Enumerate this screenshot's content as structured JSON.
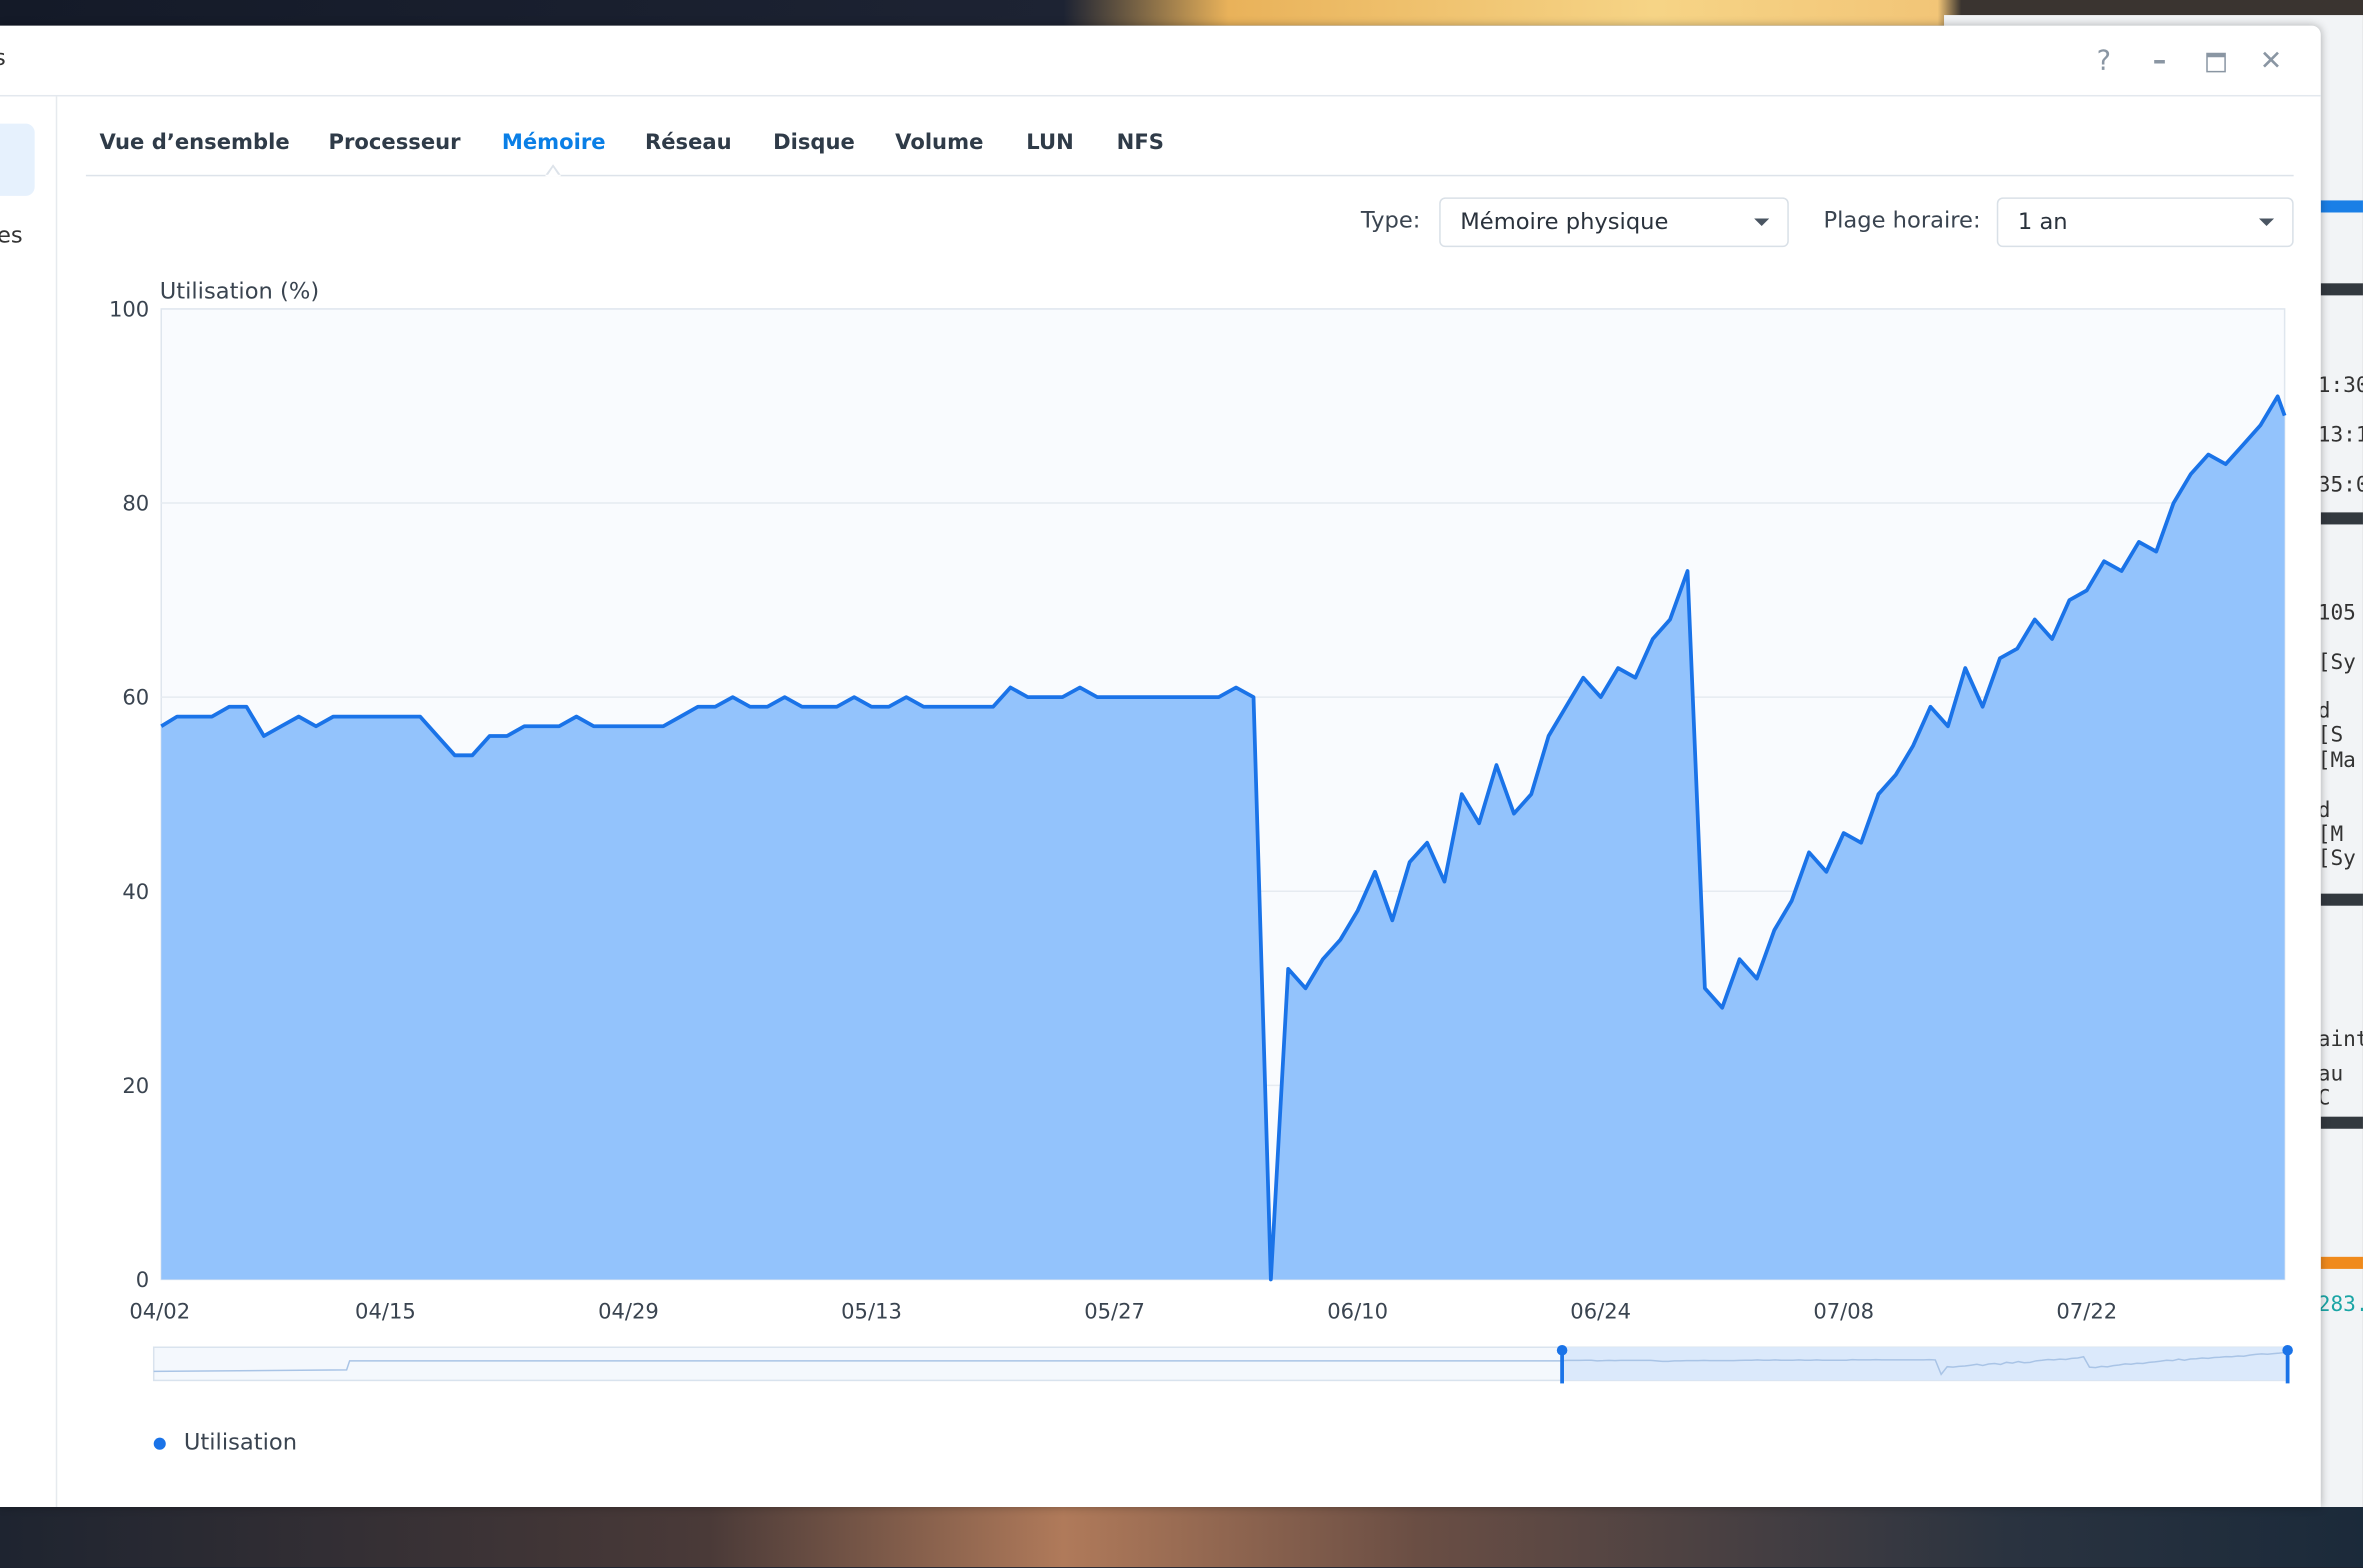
{
  "window": {
    "title_fragment": "s",
    "controls": {
      "help": "?",
      "minimize": "–",
      "maximize": "▭",
      "close": "✕"
    },
    "sidebar_fragment": "es"
  },
  "tabs": [
    {
      "label": "Vue d’ensemble",
      "active": false
    },
    {
      "label": "Processeur",
      "active": false
    },
    {
      "label": "Mémoire",
      "active": true
    },
    {
      "label": "Réseau",
      "active": false
    },
    {
      "label": "Disque",
      "active": false
    },
    {
      "label": "Volume",
      "active": false
    },
    {
      "label": "LUN",
      "active": false
    },
    {
      "label": "NFS",
      "active": false
    }
  ],
  "filters": {
    "type_label": "Type:",
    "type_value": "Mémoire physique",
    "range_label": "Plage horaire:",
    "range_value": "1 an"
  },
  "colors": {
    "accent": "#0a7fe6",
    "series_line": "#1a73e8",
    "series_fill": "#93c3fc"
  },
  "background_window_fragments": [
    "1:30",
    "13:1",
    "35:0",
    "105",
    "[Sy",
    "d [S",
    "[Ma",
    "d [M",
    "[Sy",
    "ainte",
    "au C",
    "283."
  ],
  "chart_data": {
    "type": "area",
    "title": "",
    "ylabel": "Utilisation (%)",
    "xlabel": "",
    "ylim": [
      0,
      100
    ],
    "yticks": [
      0,
      20,
      40,
      60,
      80,
      100
    ],
    "xticks": [
      "04/02",
      "04/15",
      "04/29",
      "05/13",
      "05/27",
      "06/10",
      "06/24",
      "07/08",
      "07/22"
    ],
    "grid": true,
    "legend_position": "bottom-left",
    "navigator_selection": [
      0.66,
      1.0
    ],
    "x": [
      "04/02",
      "04/03",
      "04/04",
      "04/05",
      "04/06",
      "04/07",
      "04/08",
      "04/09",
      "04/10",
      "04/11",
      "04/12",
      "04/13",
      "04/14",
      "04/15",
      "04/16",
      "04/17",
      "04/18",
      "04/19",
      "04/20",
      "04/21",
      "04/22",
      "04/23",
      "04/24",
      "04/25",
      "04/26",
      "04/27",
      "04/28",
      "04/29",
      "04/30",
      "05/01",
      "05/02",
      "05/03",
      "05/04",
      "05/05",
      "05/06",
      "05/07",
      "05/08",
      "05/09",
      "05/10",
      "05/11",
      "05/12",
      "05/13",
      "05/14",
      "05/15",
      "05/16",
      "05/17",
      "05/18",
      "05/19",
      "05/20",
      "05/21",
      "05/22",
      "05/23",
      "05/24",
      "05/25",
      "05/26",
      "05/27",
      "05/28",
      "05/29",
      "05/30",
      "05/31",
      "06/01",
      "06/02",
      "06/03",
      "06/04",
      "06/05",
      "06/06",
      "06/07",
      "06/08",
      "06/09",
      "06/10",
      "06/11",
      "06/12",
      "06/13",
      "06/14",
      "06/15",
      "06/16",
      "06/17",
      "06/18",
      "06/19",
      "06/20",
      "06/21",
      "06/22",
      "06/23",
      "06/24",
      "06/25",
      "06/26",
      "06/27",
      "06/28",
      "06/29",
      "06/30",
      "07/01",
      "07/02",
      "07/03",
      "07/04",
      "07/05",
      "07/06",
      "07/07",
      "07/08",
      "07/09",
      "07/10",
      "07/11",
      "07/12",
      "07/13",
      "07/14",
      "07/15",
      "07/16",
      "07/17",
      "07/18",
      "07/19",
      "07/20",
      "07/21",
      "07/22",
      "07/23",
      "07/24",
      "07/25",
      "07/26",
      "07/27",
      "07/28",
      "07/29",
      "07/30",
      "07/31",
      "08/01",
      "08/02",
      "08/03"
    ],
    "series": [
      {
        "name": "Utilisation",
        "values": [
          57,
          58,
          58,
          58,
          59,
          59,
          56,
          57,
          58,
          57,
          58,
          58,
          58,
          58,
          58,
          58,
          56,
          54,
          54,
          56,
          56,
          57,
          57,
          57,
          58,
          57,
          57,
          57,
          57,
          57,
          58,
          59,
          59,
          60,
          59,
          59,
          60,
          59,
          59,
          59,
          60,
          59,
          59,
          60,
          59,
          59,
          59,
          59,
          59,
          61,
          60,
          60,
          60,
          61,
          60,
          60,
          60,
          60,
          60,
          60,
          60,
          60,
          61,
          60,
          0,
          32,
          30,
          33,
          35,
          38,
          42,
          37,
          43,
          45,
          41,
          50,
          47,
          53,
          48,
          50,
          56,
          59,
          62,
          60,
          63,
          62,
          66,
          68,
          73,
          30,
          28,
          33,
          31,
          36,
          39,
          44,
          42,
          46,
          45,
          50,
          52,
          55,
          59,
          57,
          63,
          59,
          64,
          65,
          68,
          66,
          70,
          71,
          74,
          73,
          76,
          75,
          80,
          83,
          85,
          84,
          86,
          88,
          91,
          89
        ]
      }
    ]
  }
}
